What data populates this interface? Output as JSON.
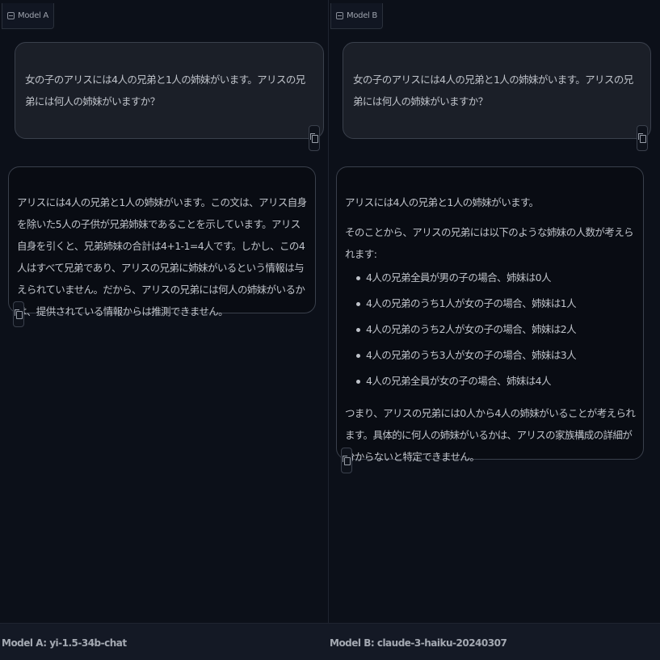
{
  "panes": {
    "a": {
      "tab_label": "Model A",
      "user_message": "女の子のアリスには4人の兄弟と1人の姉妹がいます。アリスの兄弟には何人の姉妹がいますか？",
      "response": "アリスには4人の兄弟と1人の姉妹がいます。この文は、アリス自身を除いた5人の子供が兄弟姉妹であることを示しています。アリス自身を引くと、兄弟姉妹の合計は4+1-1=4人です。しかし、この4人はすべて兄弟であり、アリスの兄弟に姉妹がいるという情報は与えられていません。だから、アリスの兄弟には何人の姉妹がいるかは、提供されている情報からは推測できません。",
      "footer_label": "Model A: yi-1.5-34b-chat"
    },
    "b": {
      "tab_label": "Model B",
      "user_message": "女の子のアリスには4人の兄弟と1人の姉妹がいます。アリスの兄弟には何人の姉妹がいますか？",
      "response_intro": "アリスには4人の兄弟と1人の姉妹がいます。",
      "response_lead": "そのことから、アリスの兄弟には以下のような姉妹の人数が考えられます:",
      "response_bullets": [
        "4人の兄弟全員が男の子の場合、姉妹は0人",
        "4人の兄弟のうち1人が女の子の場合、姉妹は1人",
        "4人の兄弟のうち2人が女の子の場合、姉妹は2人",
        "4人の兄弟のうち3人が女の子の場合、姉妹は3人",
        "4人の兄弟全員が女の子の場合、姉妹は4人"
      ],
      "response_outro": "つまり、アリスの兄弟には0人から4人の姉妹がいることが考えられます。具体的に何人の姉妹がいるかは、アリスの家族構成の詳細が分からないと特定できません。",
      "footer_label": "Model B: claude-3-haiku-20240307"
    }
  },
  "icons": {
    "tab": "chat-bubble-icon",
    "copy": "copy-icon"
  },
  "colors": {
    "background": "#0b0f19",
    "user_bubble": "#1b1f28",
    "bot_bubble": "#090c13",
    "border": "#3a404c",
    "text": "#bfc3ca"
  }
}
